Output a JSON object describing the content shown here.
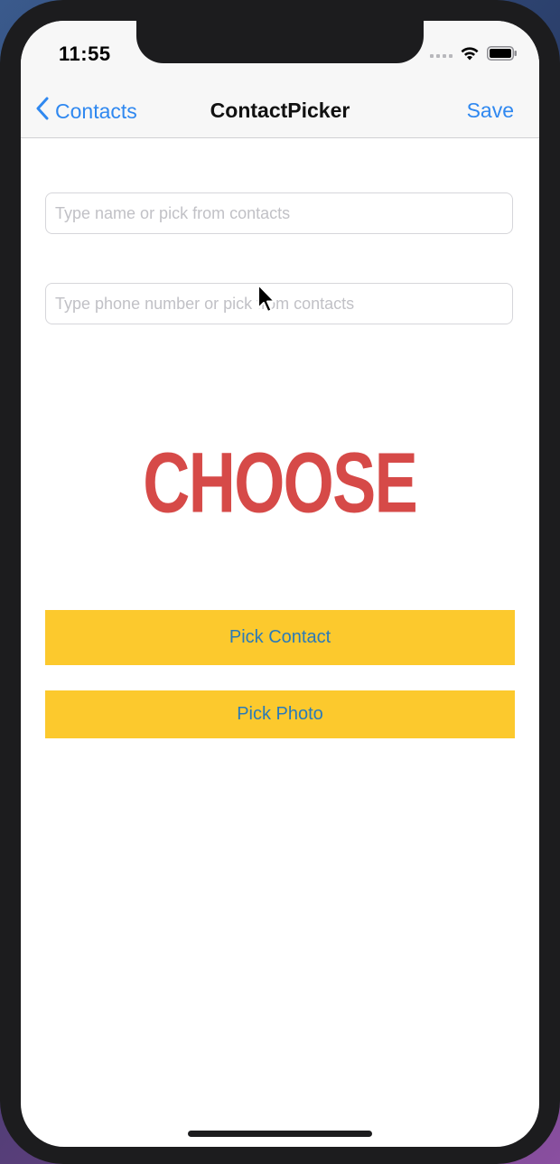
{
  "status_bar": {
    "time": "11:55"
  },
  "nav": {
    "back_label": "Contacts",
    "title": "ContactPicker",
    "save_label": "Save"
  },
  "form": {
    "name_field": {
      "value": "",
      "placeholder": "Type name or pick from contacts"
    },
    "phone_field": {
      "value": "",
      "placeholder": "Type phone number or pick from contacts"
    }
  },
  "image": {
    "text": "CHOOSE"
  },
  "buttons": {
    "pick_contact": "Pick Contact",
    "pick_photo": "Pick Photo"
  },
  "colors": {
    "accent_blue": "#2f88f0",
    "button_yellow": "#fcc92d",
    "button_text": "#2a7ab8",
    "choose_red": "#d64a48"
  }
}
